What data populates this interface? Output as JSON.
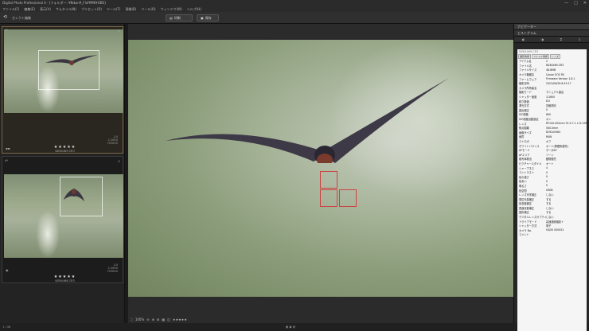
{
  "app": {
    "title": "Digital Photo Professional 4 - [フォルダー: ¥Nikon¥_Flof¥MK¥OBS]"
  },
  "menu": [
    "ファイル(F)",
    "編集(E)",
    "表示(V)",
    "サムネイル(N)",
    "プリセット(R)",
    "ツール(T)",
    "現像(B)",
    "ツール(O)",
    "ウィンドウ(W)",
    "ヘルプ(H)"
  ],
  "toolbar": {
    "crumb": "セレクト編集",
    "btn1": "印刷",
    "btn2": "保存"
  },
  "thumbs": [
    {
      "stars": "★★★★★",
      "file": "NZ64469.CR3",
      "meta": [
        "1/4",
        "1/1600",
        "ISO800"
      ]
    },
    {
      "stars": "★★★★★",
      "file": "NZ64468.CR3",
      "meta": [
        "1/4",
        "1/1600",
        "ISO800"
      ]
    }
  ],
  "bottombar": {
    "zoom": "100%"
  },
  "status": {
    "left": "1 / 48",
    "right": "4/16 / 4018"
  },
  "panel": {
    "header": "ナビゲーター",
    "header2": "ヒストグラム",
    "info_title": "NZ64469.CR3",
    "tabs": [
      "撮影情報",
      "ファイル情報",
      "レンズ"
    ],
    "rows": [
      [
        "アイテム名",
        "2"
      ],
      [
        "ファイル名",
        "NZ64469.CR3"
      ],
      [
        "ファイルサイズ",
        "48.8MB"
      ],
      [
        "カメラ機種名",
        "Canon EOS R5"
      ],
      [
        "ファームウェア",
        "Firmware Version 1.8.1"
      ],
      [
        "撮影日時",
        "2022/06/26 8:43:17"
      ],
      [
        "カメラ所有者名",
        ""
      ],
      [
        "撮影モード",
        "マニュアル露出"
      ],
      [
        "シャッター速度",
        "1/1600"
      ],
      [
        "絞り数値",
        "8.0"
      ],
      [
        "測光方式",
        "評価測光"
      ],
      [
        "露出補正",
        "0"
      ],
      [
        "ISO感度",
        "800"
      ],
      [
        "ISO感度自動設定",
        "オン"
      ],
      [
        "レンズ",
        "RF100-500mm F4.5-7.1 L IS USM"
      ],
      [
        "焦点距離",
        "500.0mm"
      ],
      [
        "画像サイズ",
        "8192x5464"
      ],
      [
        "画質",
        "RAW"
      ],
      [
        "ストロボ",
        "オフ"
      ],
      [
        "ホワイトバランス",
        "オート(雰囲気優先)"
      ],
      [
        "AFモード",
        "サーボAF"
      ],
      [
        "AFエリア",
        "ゾーン"
      ],
      [
        "被写体検出",
        "動物優先"
      ],
      [
        "ピクチャースタイル",
        "オート"
      ],
      [
        "シャープネス",
        "4"
      ],
      [
        "コントラスト",
        "0"
      ],
      [
        "色の濃さ",
        "0"
      ],
      [
        "色あい",
        "0"
      ],
      [
        "明るさ",
        "0"
      ],
      [
        "色空間",
        "sRGB"
      ],
      [
        "レンズ光学補正",
        "しない"
      ],
      [
        "周辺光量補正",
        "する"
      ],
      [
        "色収差補正",
        "する"
      ],
      [
        "歪曲収差補正",
        "しない"
      ],
      [
        "回折補正",
        "する"
      ],
      [
        "デジタルレンズオプティマイザ",
        "しない"
      ],
      [
        "ドライブモード",
        "高速連続撮影+"
      ],
      [
        "シャッター方式",
        "電子"
      ],
      [
        "カメラ No.",
        "04/00 000052"
      ],
      [
        "コメント",
        ""
      ]
    ]
  }
}
